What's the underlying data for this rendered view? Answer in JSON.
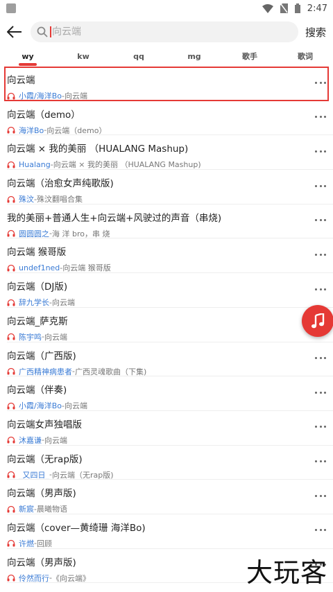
{
  "status_bar": {
    "time": "2:47"
  },
  "search": {
    "placeholder": "向云端",
    "button_label": "搜索"
  },
  "tabs": [
    "wy",
    "kw",
    "qq",
    "mg",
    "歌手",
    "歌词"
  ],
  "songs": [
    {
      "title": "向云端",
      "artist": "小霞/海洋Bo",
      "album": "向云端"
    },
    {
      "title": "向云端（demo）",
      "artist": "海洋Bo",
      "album": "向云端（demo）"
    },
    {
      "title": "向云端 × 我的美丽 （HUALANG Mashup)",
      "artist": "Hualang",
      "album": "向云端 × 我的美丽 （HUALANG Mashup)"
    },
    {
      "title": "向云端（治愈女声纯歌版)",
      "artist": "殊汶",
      "album": "殊汶翻唱合集"
    },
    {
      "title": "我的美丽+普通人生+向云端+风驶过的声音（串烧)",
      "artist": "圆圆圆之",
      "album": "海 洋 bro，串 烧"
    },
    {
      "title": "向云端 猴哥版",
      "artist": "undef1ned",
      "album": "向云端 猴哥版"
    },
    {
      "title": "向云端（DJ版)",
      "artist": "辞九学长",
      "album": "向云端"
    },
    {
      "title": "向云端_萨克斯",
      "artist": "陈宇鸣",
      "album": "向云端"
    },
    {
      "title": "向云端（广西版)",
      "artist": "广西精神病患者",
      "album": "广西灵魂歌曲（下集)"
    },
    {
      "title": "向云端（伴奏)",
      "artist": "小霞/海洋Bo",
      "album": "向云端"
    },
    {
      "title": "向云端女声独唱版",
      "artist": "沐嘉谦",
      "album": "向云端"
    },
    {
      "title": "向云端（无rap版)",
      "artist": "_又四日_",
      "album": "向云端（无rap版)"
    },
    {
      "title": "向云端（男声版)",
      "artist": "新宸",
      "album": "晨曦物语"
    },
    {
      "title": "向云端（cover—黄绮珊 海洋Bo)",
      "artist": "许燃",
      "album": "回顾"
    },
    {
      "title": "向云端（男声版)",
      "artist": "伶然而行",
      "album": "《向云端》"
    }
  ],
  "separator": " - ",
  "watermark": "大玩客",
  "colors": {
    "accent": "#e53935",
    "artist": "#3a7bd5"
  }
}
